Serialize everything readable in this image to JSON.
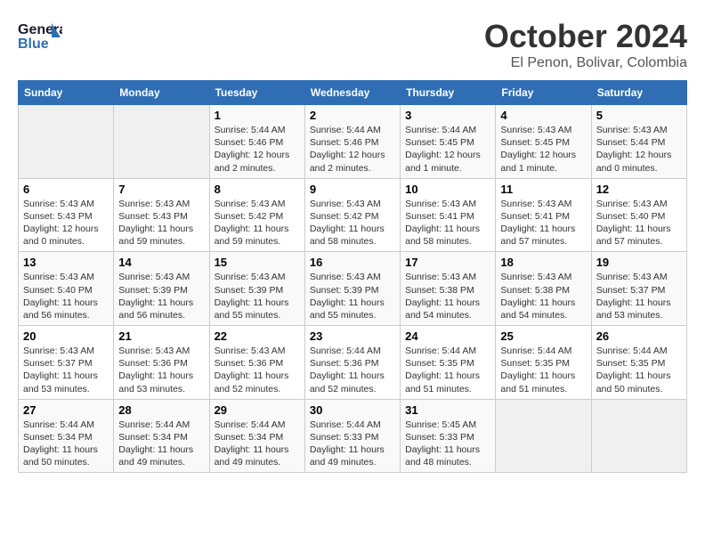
{
  "logo": {
    "line1": "General",
    "line2": "Blue"
  },
  "header": {
    "month": "October 2024",
    "location": "El Penon, Bolivar, Colombia"
  },
  "days_of_week": [
    "Sunday",
    "Monday",
    "Tuesday",
    "Wednesday",
    "Thursday",
    "Friday",
    "Saturday"
  ],
  "weeks": [
    [
      {
        "day": "",
        "info": ""
      },
      {
        "day": "",
        "info": ""
      },
      {
        "day": "1",
        "info": "Sunrise: 5:44 AM\nSunset: 5:46 PM\nDaylight: 12 hours\nand 2 minutes."
      },
      {
        "day": "2",
        "info": "Sunrise: 5:44 AM\nSunset: 5:46 PM\nDaylight: 12 hours\nand 2 minutes."
      },
      {
        "day": "3",
        "info": "Sunrise: 5:44 AM\nSunset: 5:45 PM\nDaylight: 12 hours\nand 1 minute."
      },
      {
        "day": "4",
        "info": "Sunrise: 5:43 AM\nSunset: 5:45 PM\nDaylight: 12 hours\nand 1 minute."
      },
      {
        "day": "5",
        "info": "Sunrise: 5:43 AM\nSunset: 5:44 PM\nDaylight: 12 hours\nand 0 minutes."
      }
    ],
    [
      {
        "day": "6",
        "info": "Sunrise: 5:43 AM\nSunset: 5:43 PM\nDaylight: 12 hours\nand 0 minutes."
      },
      {
        "day": "7",
        "info": "Sunrise: 5:43 AM\nSunset: 5:43 PM\nDaylight: 11 hours\nand 59 minutes."
      },
      {
        "day": "8",
        "info": "Sunrise: 5:43 AM\nSunset: 5:42 PM\nDaylight: 11 hours\nand 59 minutes."
      },
      {
        "day": "9",
        "info": "Sunrise: 5:43 AM\nSunset: 5:42 PM\nDaylight: 11 hours\nand 58 minutes."
      },
      {
        "day": "10",
        "info": "Sunrise: 5:43 AM\nSunset: 5:41 PM\nDaylight: 11 hours\nand 58 minutes."
      },
      {
        "day": "11",
        "info": "Sunrise: 5:43 AM\nSunset: 5:41 PM\nDaylight: 11 hours\nand 57 minutes."
      },
      {
        "day": "12",
        "info": "Sunrise: 5:43 AM\nSunset: 5:40 PM\nDaylight: 11 hours\nand 57 minutes."
      }
    ],
    [
      {
        "day": "13",
        "info": "Sunrise: 5:43 AM\nSunset: 5:40 PM\nDaylight: 11 hours\nand 56 minutes."
      },
      {
        "day": "14",
        "info": "Sunrise: 5:43 AM\nSunset: 5:39 PM\nDaylight: 11 hours\nand 56 minutes."
      },
      {
        "day": "15",
        "info": "Sunrise: 5:43 AM\nSunset: 5:39 PM\nDaylight: 11 hours\nand 55 minutes."
      },
      {
        "day": "16",
        "info": "Sunrise: 5:43 AM\nSunset: 5:39 PM\nDaylight: 11 hours\nand 55 minutes."
      },
      {
        "day": "17",
        "info": "Sunrise: 5:43 AM\nSunset: 5:38 PM\nDaylight: 11 hours\nand 54 minutes."
      },
      {
        "day": "18",
        "info": "Sunrise: 5:43 AM\nSunset: 5:38 PM\nDaylight: 11 hours\nand 54 minutes."
      },
      {
        "day": "19",
        "info": "Sunrise: 5:43 AM\nSunset: 5:37 PM\nDaylight: 11 hours\nand 53 minutes."
      }
    ],
    [
      {
        "day": "20",
        "info": "Sunrise: 5:43 AM\nSunset: 5:37 PM\nDaylight: 11 hours\nand 53 minutes."
      },
      {
        "day": "21",
        "info": "Sunrise: 5:43 AM\nSunset: 5:36 PM\nDaylight: 11 hours\nand 53 minutes."
      },
      {
        "day": "22",
        "info": "Sunrise: 5:43 AM\nSunset: 5:36 PM\nDaylight: 11 hours\nand 52 minutes."
      },
      {
        "day": "23",
        "info": "Sunrise: 5:44 AM\nSunset: 5:36 PM\nDaylight: 11 hours\nand 52 minutes."
      },
      {
        "day": "24",
        "info": "Sunrise: 5:44 AM\nSunset: 5:35 PM\nDaylight: 11 hours\nand 51 minutes."
      },
      {
        "day": "25",
        "info": "Sunrise: 5:44 AM\nSunset: 5:35 PM\nDaylight: 11 hours\nand 51 minutes."
      },
      {
        "day": "26",
        "info": "Sunrise: 5:44 AM\nSunset: 5:35 PM\nDaylight: 11 hours\nand 50 minutes."
      }
    ],
    [
      {
        "day": "27",
        "info": "Sunrise: 5:44 AM\nSunset: 5:34 PM\nDaylight: 11 hours\nand 50 minutes."
      },
      {
        "day": "28",
        "info": "Sunrise: 5:44 AM\nSunset: 5:34 PM\nDaylight: 11 hours\nand 49 minutes."
      },
      {
        "day": "29",
        "info": "Sunrise: 5:44 AM\nSunset: 5:34 PM\nDaylight: 11 hours\nand 49 minutes."
      },
      {
        "day": "30",
        "info": "Sunrise: 5:44 AM\nSunset: 5:33 PM\nDaylight: 11 hours\nand 49 minutes."
      },
      {
        "day": "31",
        "info": "Sunrise: 5:45 AM\nSunset: 5:33 PM\nDaylight: 11 hours\nand 48 minutes."
      },
      {
        "day": "",
        "info": ""
      },
      {
        "day": "",
        "info": ""
      }
    ]
  ]
}
